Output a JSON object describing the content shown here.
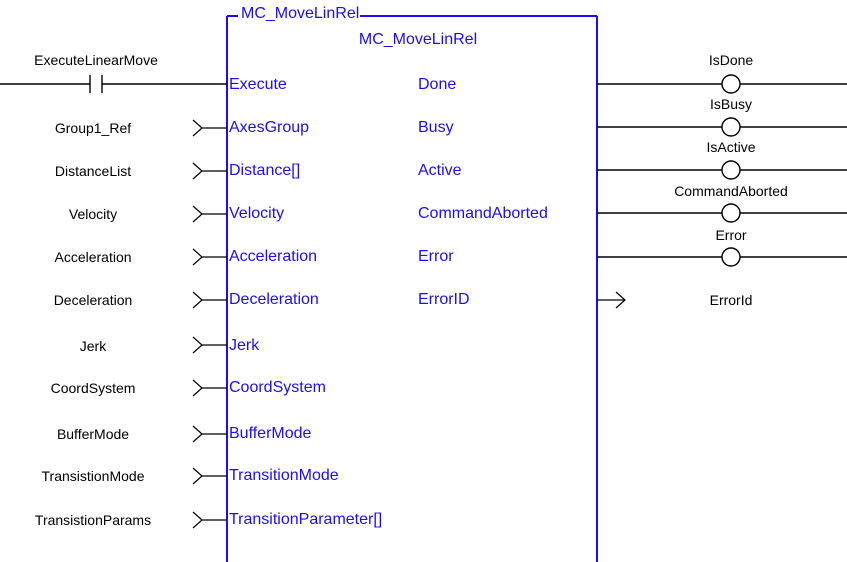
{
  "block": {
    "instance_name": "MC_MoveLinRel",
    "type_name": "MC_MoveLinRel"
  },
  "contact": {
    "variable": "ExecuteLinearMove"
  },
  "inputs": [
    {
      "variable": "Group1_Ref",
      "pin": "AxesGroup"
    },
    {
      "variable": "DistanceList",
      "pin": "Distance[]"
    },
    {
      "variable": "Velocity",
      "pin": "Velocity"
    },
    {
      "variable": "Acceleration",
      "pin": "Acceleration"
    },
    {
      "variable": "Deceleration",
      "pin": "Deceleration"
    },
    {
      "variable": "Jerk",
      "pin": "Jerk"
    },
    {
      "variable": "CoordSystem",
      "pin": "CoordSystem"
    },
    {
      "variable": "BufferMode",
      "pin": "BufferMode"
    },
    {
      "variable": "TransistionMode",
      "pin": "TransitionMode"
    },
    {
      "variable": "TransistionParams",
      "pin": "TransitionParameter[]"
    }
  ],
  "execute_pin": "Execute",
  "outputs": [
    {
      "pin": "Done",
      "variable": "IsDone"
    },
    {
      "pin": "Busy",
      "variable": "IsBusy"
    },
    {
      "pin": "Active",
      "variable": "IsActive"
    },
    {
      "pin": "CommandAborted",
      "variable": "CommandAborted"
    },
    {
      "pin": "Error",
      "variable": "Error"
    },
    {
      "pin": "ErrorID",
      "variable": "ErrorId"
    }
  ],
  "colors": {
    "block_line": "#1a0dff",
    "wire": "#000000",
    "pin_text": "#1a0dff",
    "variable_text": "#000000"
  }
}
